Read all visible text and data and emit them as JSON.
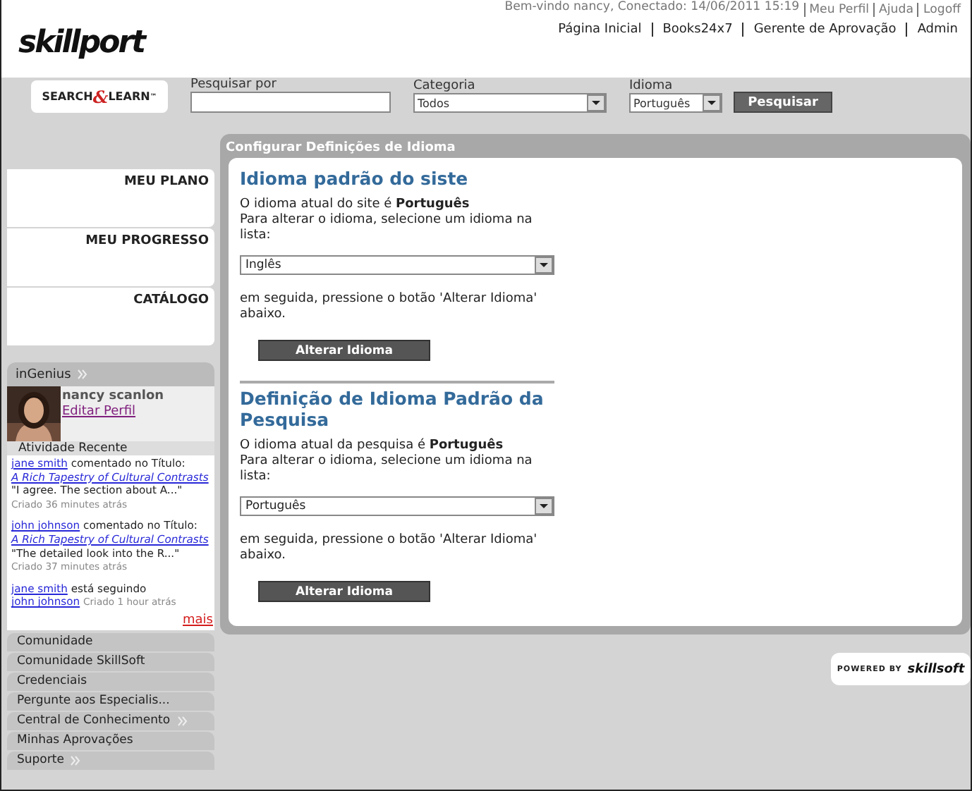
{
  "top_bar": {
    "welcome": "Bem-vindo nancy, Conectado: 14/06/2011 15:19",
    "links": [
      "Meu Perfil",
      "Ajuda",
      "Logoff"
    ]
  },
  "logo": "skillport",
  "nav": [
    "Página Inicial",
    "Books24x7",
    "Gerente de Aprovação",
    "Admin"
  ],
  "search": {
    "logo_parts": [
      "SEARCH",
      "&",
      "LEARN",
      "™"
    ],
    "fields": [
      {
        "kind": "input",
        "label": "Pesquisar por"
      },
      {
        "kind": "select",
        "label": "Categoria",
        "value": "Todos"
      },
      {
        "kind": "select",
        "label": "Idioma",
        "value": "Português"
      }
    ],
    "button": "Pesquisar"
  },
  "sidebar_boxes": [
    "MEU PLANO",
    "MEU PROGRESSO",
    "CATÁLOGO"
  ],
  "ingenius": {
    "title": "inGenius",
    "name": "nancy scanlon",
    "edit_link": "Editar Perfil",
    "activity_title": "Atividade Recente",
    "activities": [
      [
        {
          "kind": "user",
          "text": "jane smith"
        },
        {
          "kind": "text",
          "text": "comentado no Título:"
        },
        {
          "kind": "title",
          "text": "A Rich Tapestry of Cultural Contrasts"
        },
        {
          "kind": "text",
          "text": "\"I agree. The section about A...\""
        },
        {
          "kind": "time",
          "text": "Criado 36 minutes atrás"
        }
      ],
      [
        {
          "kind": "user",
          "text": "john johnson"
        },
        {
          "kind": "text",
          "text": "comentado no Título:"
        },
        {
          "kind": "title",
          "text": "A Rich Tapestry of Cultural Contrasts"
        },
        {
          "kind": "text",
          "text": "\"The detailed look into the R...\""
        },
        {
          "kind": "time",
          "text": "Criado 37 minutes atrás"
        }
      ],
      [
        {
          "kind": "user",
          "text": "jane smith"
        },
        {
          "kind": "text",
          "text": "está seguindo"
        },
        {
          "kind": "user",
          "text": "john johnson"
        },
        {
          "kind": "time",
          "text": "Criado 1 hour atrás"
        }
      ]
    ],
    "more": "mais"
  },
  "menu": [
    {
      "label": "Comunidade",
      "expandable": false
    },
    {
      "label": "Comunidade SkillSoft",
      "expandable": false
    },
    {
      "label": "Credenciais",
      "expandable": false
    },
    {
      "label": "Pergunte aos Especialis...",
      "expandable": false
    },
    {
      "label": "Central de Conhecimento",
      "expandable": true
    },
    {
      "label": "Minhas Aprovações",
      "expandable": false
    },
    {
      "label": "Suporte",
      "expandable": true
    }
  ],
  "main": {
    "title": "Configurar Definições de Idioma",
    "sections": [
      {
        "heading": "Idioma padrão do siste",
        "current": "O idioma atual do site é **Português**",
        "instruction": "Para alterar o idioma, selecione um idioma na lista:",
        "select": "Inglês",
        "after": "em seguida, pressione o botão 'Alterar Idioma' abaixo.",
        "button": "Alterar Idioma"
      },
      {
        "heading": "Definição de Idioma Padrão da Pesquisa",
        "current": "O idioma atual da pesquisa é **Português**",
        "instruction": "Para alterar o idioma, selecione um idioma na lista:",
        "select": "Português",
        "after": "em seguida, pressione o botão 'Alterar Idioma' abaixo.",
        "button": "Alterar Idioma"
      }
    ]
  },
  "footer": {
    "powered": "POWERED BY",
    "brand": "skillsoft"
  }
}
